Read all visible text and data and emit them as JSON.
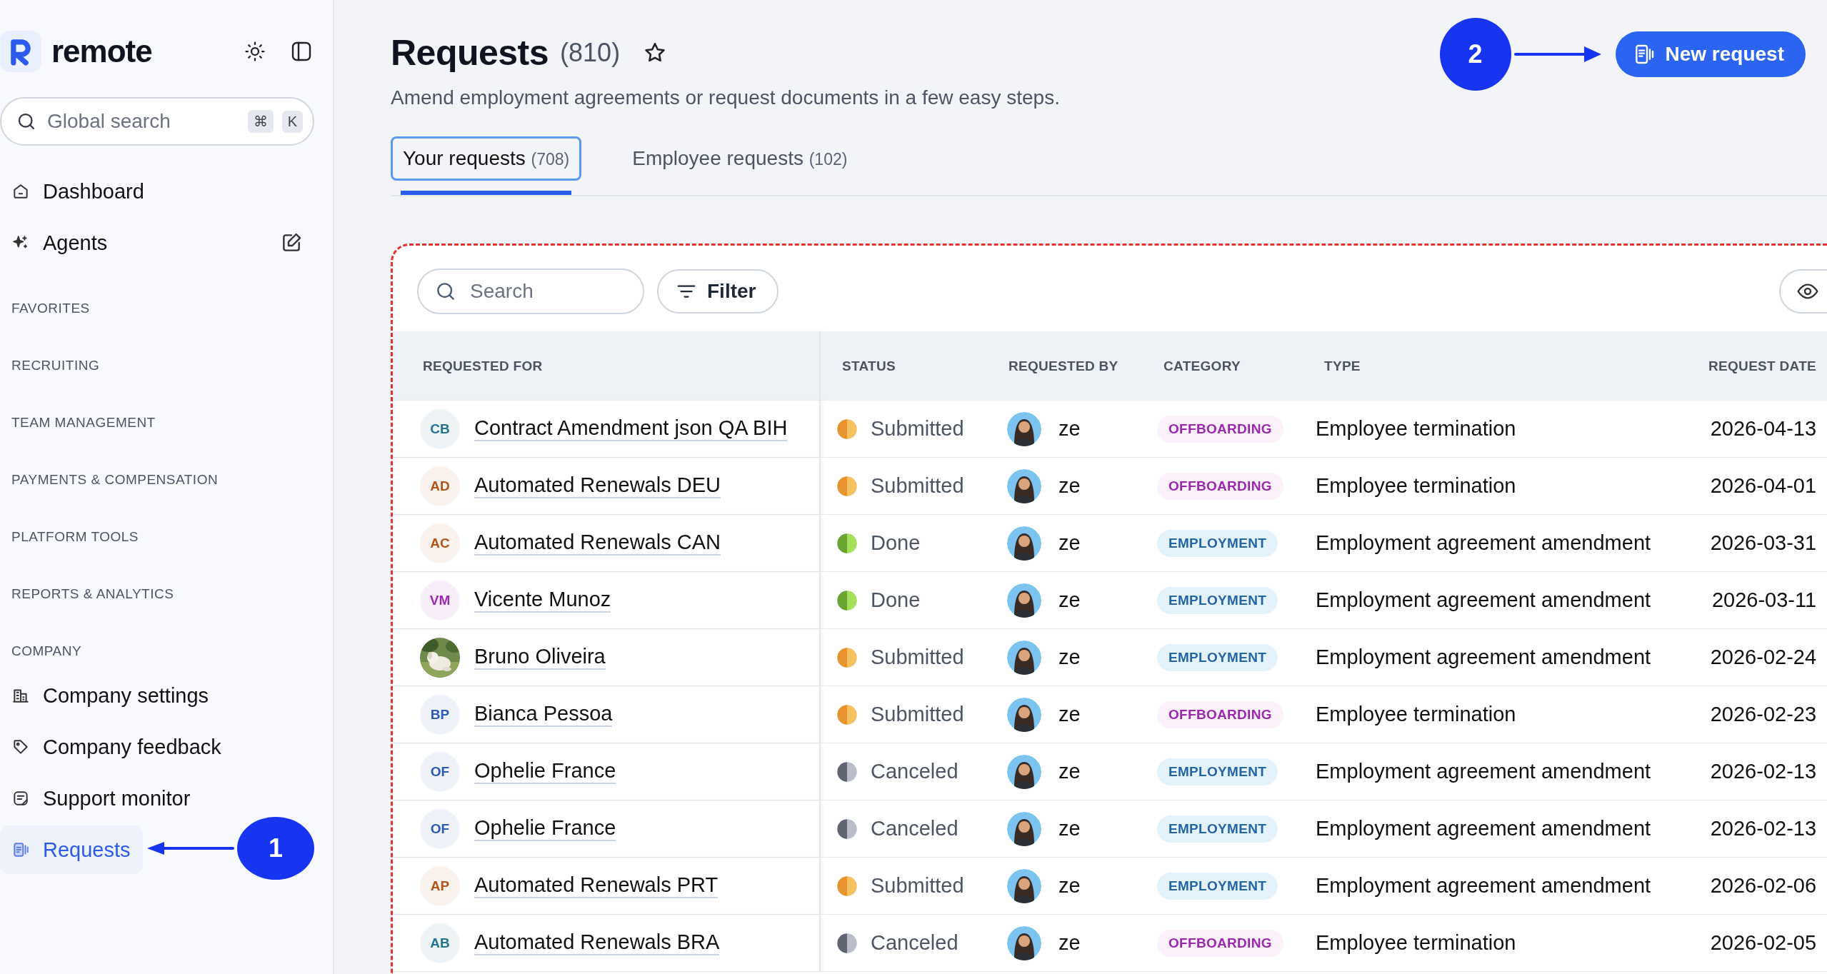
{
  "sidebar": {
    "logo": "remote",
    "search": {
      "placeholder": "Global search",
      "keys": [
        "⌘",
        "K"
      ]
    },
    "items": [
      {
        "kind": "nav",
        "label": "Dashboard",
        "selected": false
      },
      {
        "kind": "nav",
        "label": "Agents",
        "selected": false
      },
      {
        "kind": "section",
        "label": "FAVORITES"
      },
      {
        "kind": "section",
        "label": "RECRUITING"
      },
      {
        "kind": "section",
        "label": "TEAM MANAGEMENT"
      },
      {
        "kind": "section",
        "label": "PAYMENTS & COMPENSATION"
      },
      {
        "kind": "section",
        "label": "PLATFORM TOOLS"
      },
      {
        "kind": "section",
        "label": "REPORTS & ANALYTICS"
      },
      {
        "kind": "section",
        "label": "COMPANY"
      },
      {
        "kind": "nav",
        "label": "Company settings",
        "selected": false
      },
      {
        "kind": "nav",
        "label": "Company feedback",
        "selected": false
      },
      {
        "kind": "nav",
        "label": "Support monitor",
        "selected": false
      },
      {
        "kind": "nav",
        "label": "Requests",
        "selected": true,
        "annotation": "1"
      }
    ]
  },
  "page": {
    "title": "Requests",
    "count": "(810)",
    "subtitle": "Amend employment agreements or request documents in a few easy steps.",
    "button": "New request",
    "annotation": "2"
  },
  "tabs": [
    {
      "label": "Your requests",
      "count": "(708)",
      "selected": true
    },
    {
      "label": "Employee requests",
      "count": "(102)",
      "selected": false
    }
  ],
  "toolbar": {
    "search_placeholder": "Search",
    "filter": "Filter"
  },
  "table": {
    "columns": [
      "REQUESTED FOR",
      "STATUS",
      "REQUESTED BY",
      "CATEGORY",
      "TYPE",
      "REQUEST DATE"
    ],
    "rows": [
      {
        "initials": "CB",
        "color": "#23758f",
        "name": "Contract Amendment json QA BIH",
        "status": {
          "label": "Submitted",
          "kind": "submitted"
        },
        "by": "ze",
        "category": {
          "label": "OFFBOARDING",
          "kind": "offboarding"
        },
        "type": "Employee termination",
        "date": "2026-04-13"
      },
      {
        "initials": "AD",
        "color": "#b2531c",
        "name": "Automated Renewals DEU",
        "status": {
          "label": "Submitted",
          "kind": "submitted"
        },
        "by": "ze",
        "category": {
          "label": "OFFBOARDING",
          "kind": "offboarding"
        },
        "type": "Employee termination",
        "date": "2026-04-01"
      },
      {
        "initials": "AC",
        "color": "#b2531c",
        "name": "Automated Renewals CAN",
        "status": {
          "label": "Done",
          "kind": "done"
        },
        "by": "ze",
        "category": {
          "label": "EMPLOYMENT",
          "kind": "employment"
        },
        "type": "Employment agreement amendment",
        "date": "2026-03-31"
      },
      {
        "initials": "VM",
        "color": "#9c27b0",
        "name": "Vicente Munoz",
        "status": {
          "label": "Done",
          "kind": "done"
        },
        "by": "ze",
        "category": {
          "label": "EMPLOYMENT",
          "kind": "employment"
        },
        "type": "Employment agreement amendment",
        "date": "2026-03-11"
      },
      {
        "kind": "picture",
        "name": "Bruno Oliveira",
        "status": {
          "label": "Submitted",
          "kind": "submitted"
        },
        "by": "ze",
        "category": {
          "label": "EMPLOYMENT",
          "kind": "employment"
        },
        "type": "Employment agreement amendment",
        "date": "2026-02-24"
      },
      {
        "initials": "BP",
        "color": "#2d5bb8",
        "name": "Bianca Pessoa",
        "status": {
          "label": "Submitted",
          "kind": "submitted"
        },
        "by": "ze",
        "category": {
          "label": "OFFBOARDING",
          "kind": "offboarding"
        },
        "type": "Employee termination",
        "date": "2026-02-23"
      },
      {
        "initials": "OF",
        "color": "#2d5bb8",
        "name": "Ophelie France",
        "status": {
          "label": "Canceled",
          "kind": "canceled"
        },
        "by": "ze",
        "category": {
          "label": "EMPLOYMENT",
          "kind": "employment"
        },
        "type": "Employment agreement amendment",
        "date": "2026-02-13"
      },
      {
        "initials": "OF",
        "color": "#2d5bb8",
        "name": "Ophelie France",
        "status": {
          "label": "Canceled",
          "kind": "canceled"
        },
        "by": "ze",
        "category": {
          "label": "EMPLOYMENT",
          "kind": "employment"
        },
        "type": "Employment agreement amendment",
        "date": "2026-02-13"
      },
      {
        "initials": "AP",
        "color": "#b2531c",
        "name": "Automated Renewals PRT",
        "status": {
          "label": "Submitted",
          "kind": "submitted"
        },
        "by": "ze",
        "category": {
          "label": "EMPLOYMENT",
          "kind": "employment"
        },
        "type": "Employment agreement amendment",
        "date": "2026-02-06"
      },
      {
        "initials": "AB",
        "color": "#23758f",
        "name": "Automated Renewals BRA",
        "status": {
          "label": "Canceled",
          "kind": "canceled"
        },
        "by": "ze",
        "category": {
          "label": "OFFBOARDING",
          "kind": "offboarding"
        },
        "type": "Employee termination",
        "date": "2026-02-05"
      }
    ]
  }
}
